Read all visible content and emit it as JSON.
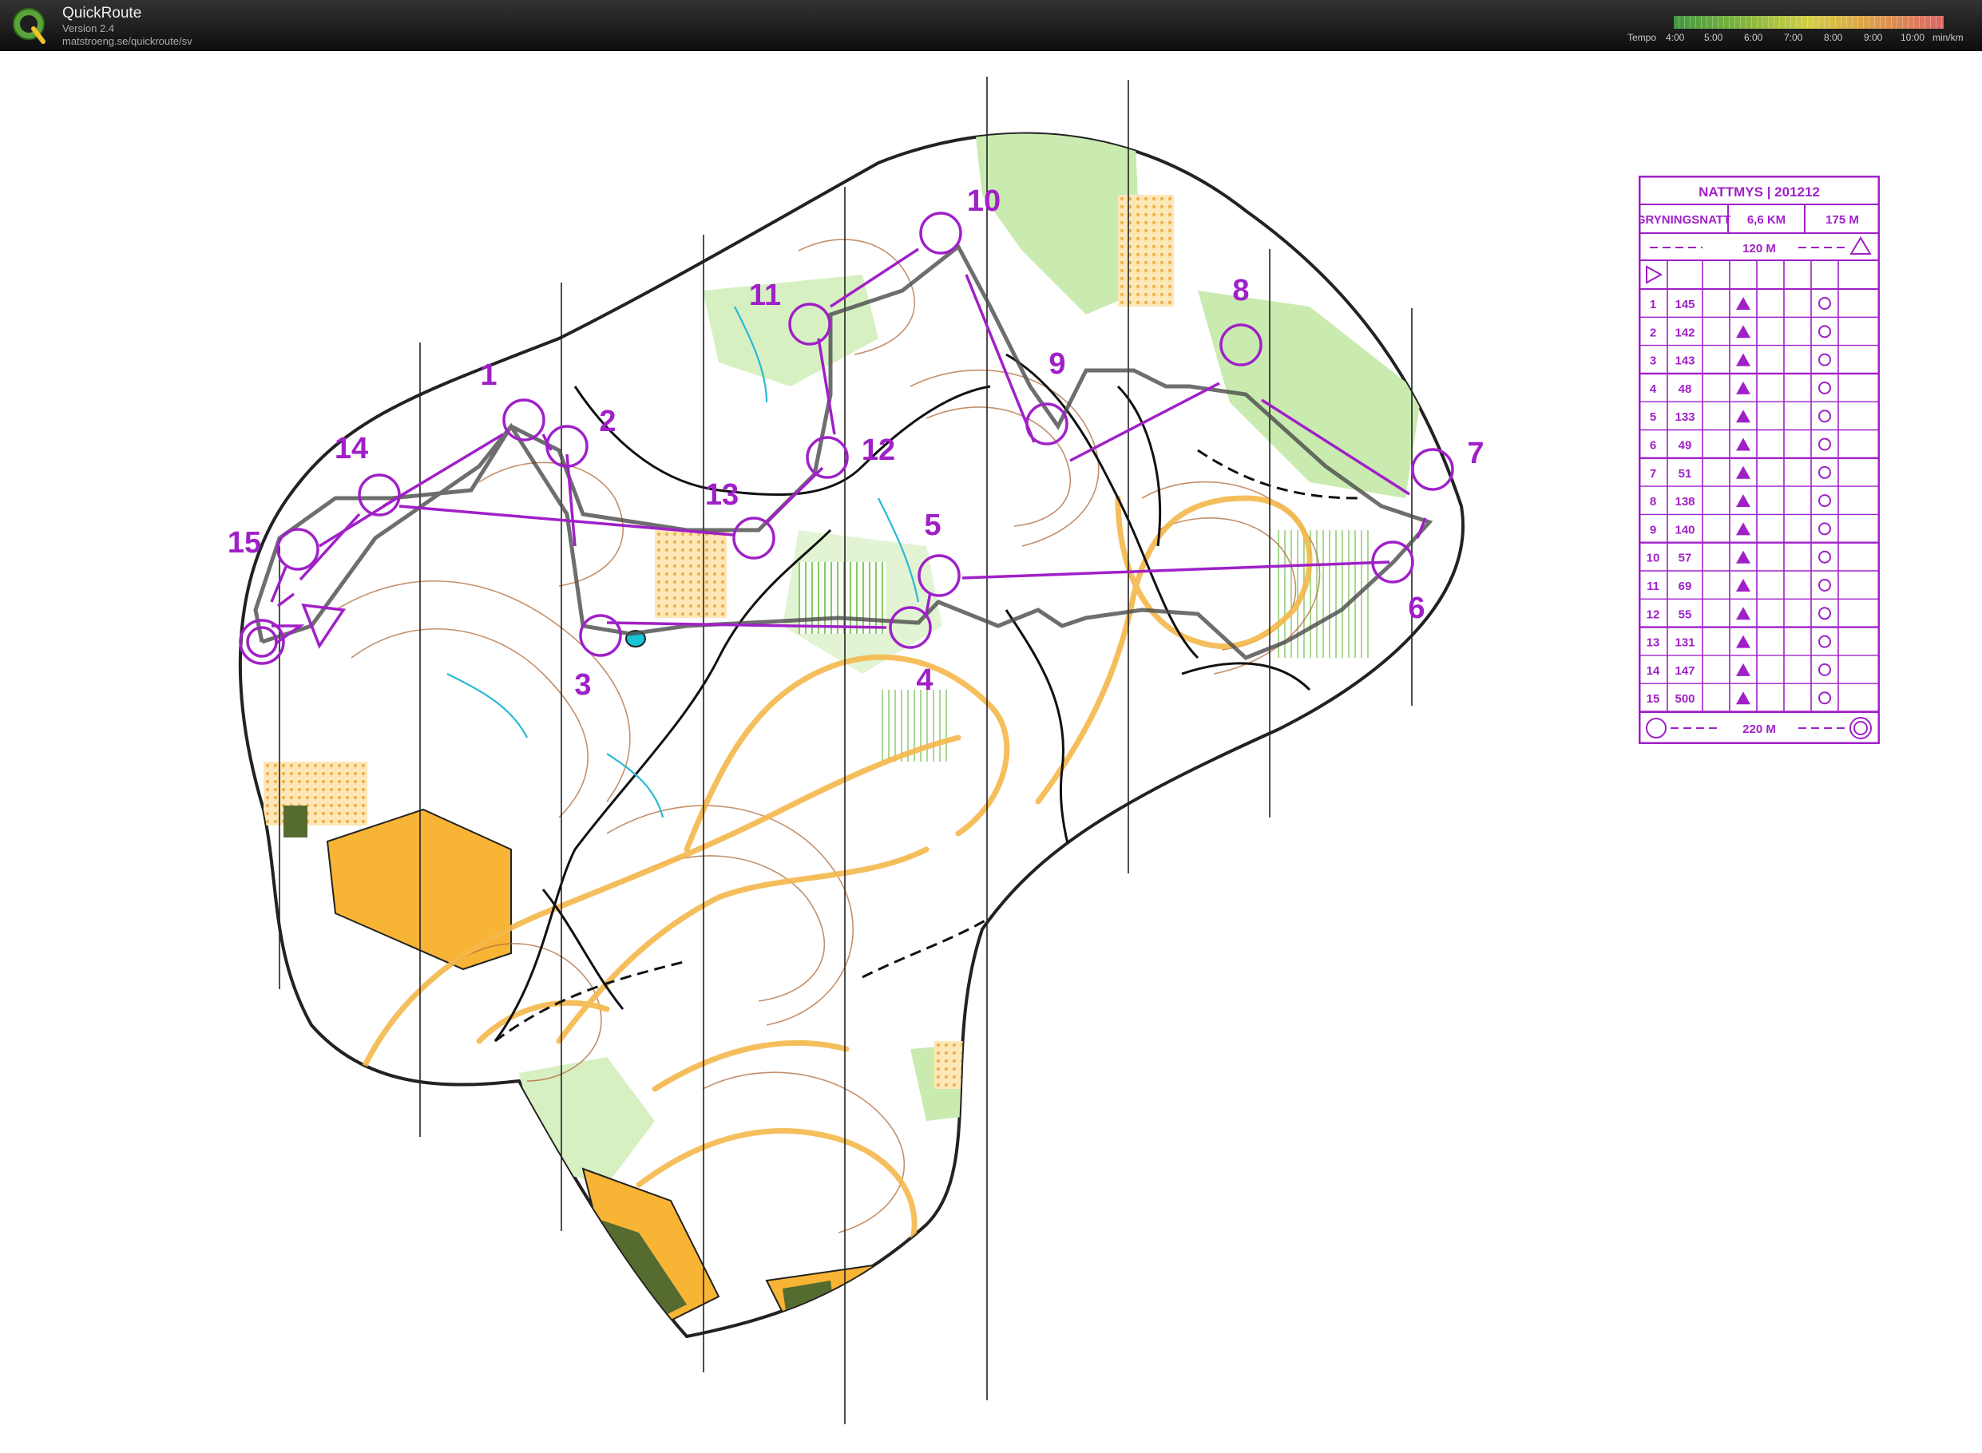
{
  "app": {
    "name": "QuickRoute",
    "version": "Version 2.4",
    "url": "matstroeng.se/quickroute/sv",
    "logo_letter": "Q"
  },
  "tempo": {
    "label": "Tempo",
    "ticks": [
      "4:00",
      "5:00",
      "6:00",
      "7:00",
      "8:00",
      "9:00",
      "10:00"
    ],
    "unit": "min/km"
  },
  "course": {
    "title": "NATTMYS  |  201212",
    "class": "GRYNINGSNATT",
    "length": "6,6 KM",
    "climb": "175 M",
    "start_marking": "120 M",
    "finish_marking": "220 M",
    "controls": [
      {
        "n": "1",
        "code": "145"
      },
      {
        "n": "2",
        "code": "142"
      },
      {
        "n": "3",
        "code": "143"
      },
      {
        "n": "4",
        "code": "48"
      },
      {
        "n": "5",
        "code": "133"
      },
      {
        "n": "6",
        "code": "49"
      },
      {
        "n": "7",
        "code": "51"
      },
      {
        "n": "8",
        "code": "138"
      },
      {
        "n": "9",
        "code": "140"
      },
      {
        "n": "10",
        "code": "57"
      },
      {
        "n": "11",
        "code": "69"
      },
      {
        "n": "12",
        "code": "55"
      },
      {
        "n": "13",
        "code": "131"
      },
      {
        "n": "14",
        "code": "147"
      },
      {
        "n": "15",
        "code": "500"
      }
    ]
  },
  "colors": {
    "course": "#a020c8",
    "route": "#4a4a4a",
    "forest": "#ffffff",
    "green": "#c9ebb0",
    "open": "#f8b435",
    "contour": "#b06a3a"
  }
}
